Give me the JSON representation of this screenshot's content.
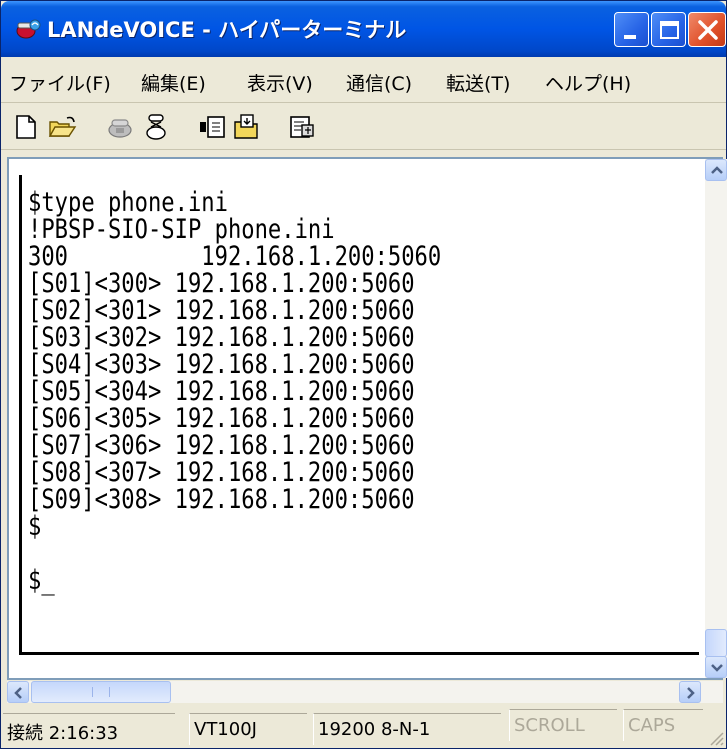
{
  "window": {
    "title": "LANdeVOICE - ハイパーターミナル",
    "app_icon": "hyperterminal-icon"
  },
  "menu": {
    "items": [
      "ファイル(F)",
      "編集(E)",
      "表示(V)",
      "通信(C)",
      "転送(T)",
      "ヘルプ(H)"
    ]
  },
  "toolbar": {
    "tools": [
      "new-icon",
      "open-icon",
      "connect-icon",
      "disconnect-icon",
      "send-icon",
      "receive-icon",
      "properties-icon"
    ]
  },
  "terminal": {
    "lines": [
      "$type phone.ini",
      "!PBSP-SIO-SIP phone.ini",
      "300          192.168.1.200:5060",
      "[S01]<300> 192.168.1.200:5060",
      "[S02]<301> 192.168.1.200:5060",
      "[S03]<302> 192.168.1.200:5060",
      "[S04]<303> 192.168.1.200:5060",
      "[S05]<304> 192.168.1.200:5060",
      "[S06]<305> 192.168.1.200:5060",
      "[S07]<306> 192.168.1.200:5060",
      "[S08]<307> 192.168.1.200:5060",
      "[S09]<308> 192.168.1.200:5060",
      "$",
      "",
      "$_"
    ]
  },
  "status": {
    "connection": "接続 2:16:33",
    "emulation": "VT100J",
    "port_settings": "19200 8-N-1",
    "scroll": "SCROLL",
    "caps": "CAPS"
  },
  "colors": {
    "title_bar": "#0055e5",
    "close_button": "#e0502a",
    "window_body": "#ece9d8",
    "terminal_bg": "#ffffff"
  }
}
